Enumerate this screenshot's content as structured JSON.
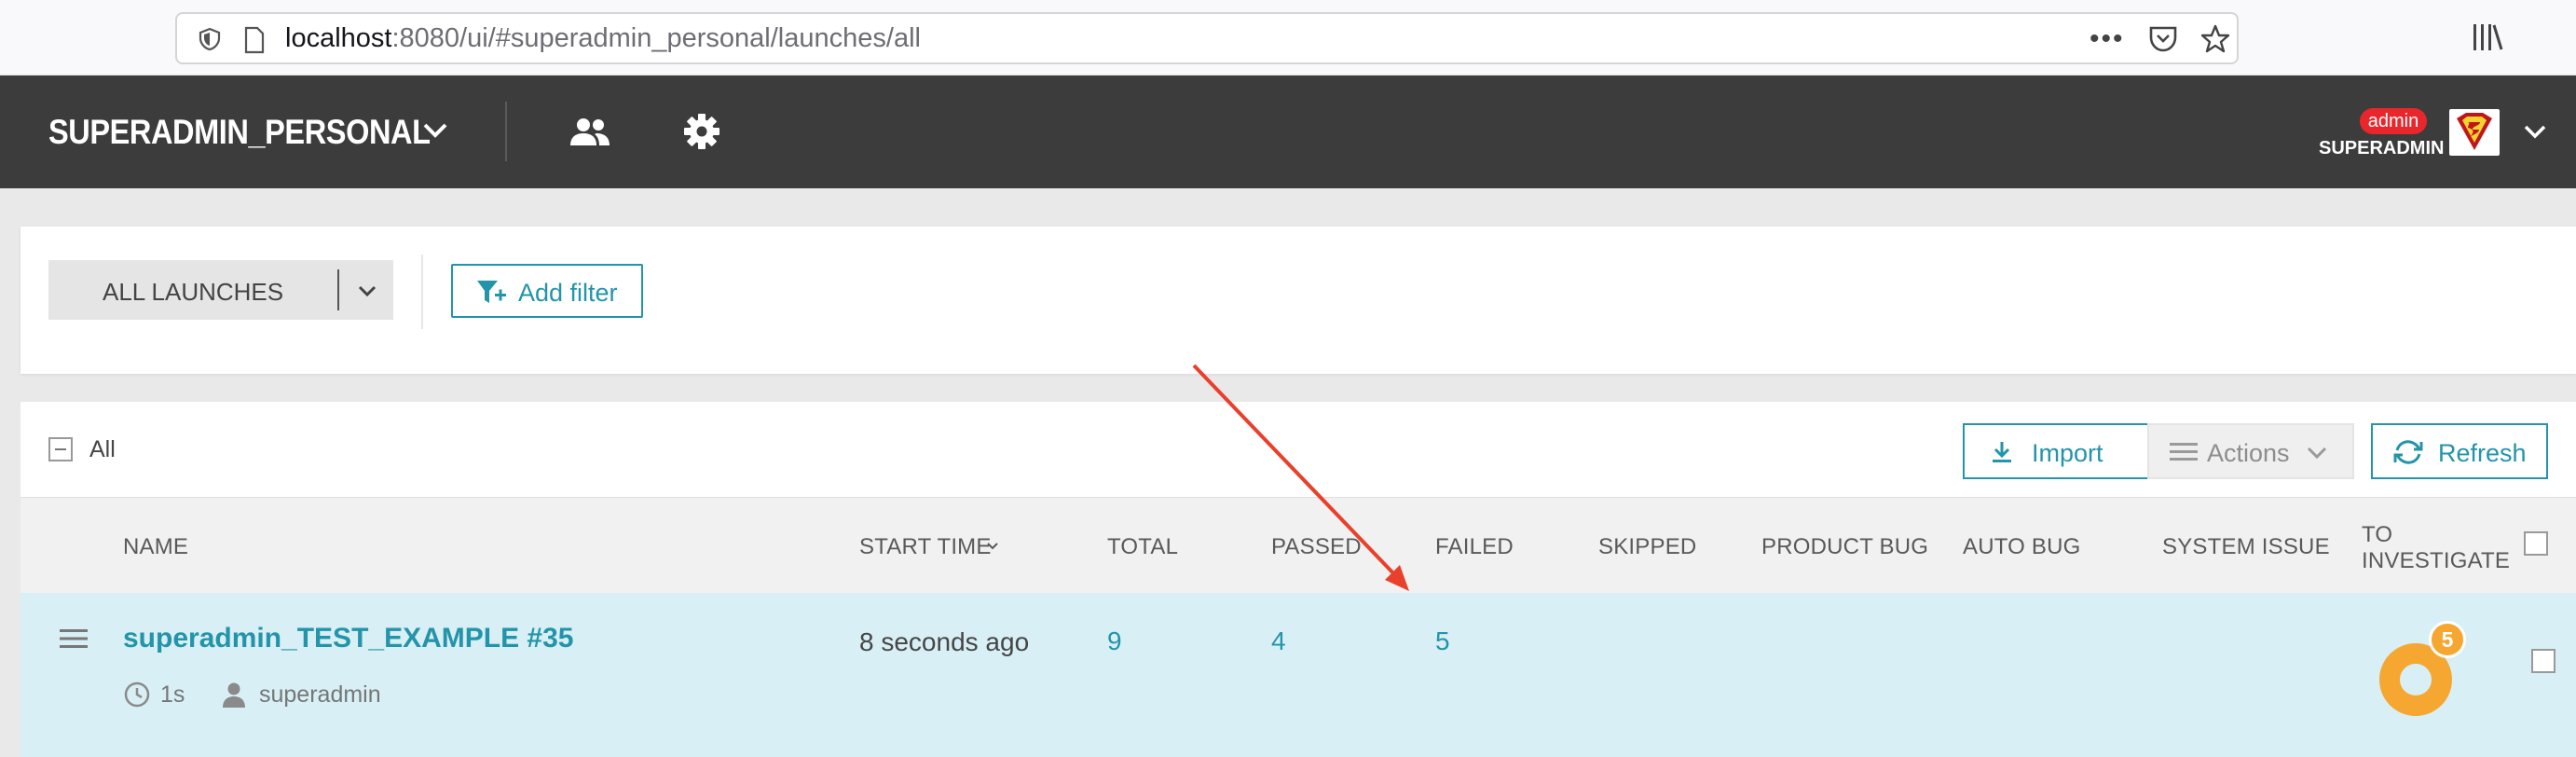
{
  "browser": {
    "url_host": "localhost",
    "url_rest": ":8080/ui/#superadmin_personal/launches/all"
  },
  "header": {
    "project_name": "SUPERADMIN_PERSONAL",
    "user_role": "admin",
    "user_name": "SUPERADMIN"
  },
  "filters": {
    "launch_select": "ALL LAUNCHES",
    "add_filter": "Add filter"
  },
  "toolbar": {
    "all_label": "All",
    "import": "Import",
    "actions": "Actions",
    "refresh": "Refresh"
  },
  "table": {
    "columns": {
      "name": "NAME",
      "start_time": "START TIME",
      "total": "TOTAL",
      "passed": "PASSED",
      "failed": "FAILED",
      "skipped": "SKIPPED",
      "product_bug": "PRODUCT BUG",
      "auto_bug": "AUTO BUG",
      "system_issue": "SYSTEM ISSUE",
      "to_investigate": "TO INVESTIGATE"
    },
    "rows": [
      {
        "name": "superadmin_TEST_EXAMPLE #35",
        "duration": "1s",
        "owner": "superadmin",
        "start_time": "8 seconds ago",
        "total": "9",
        "passed": "4",
        "failed": "5",
        "to_investigate": "5"
      }
    ]
  },
  "colors": {
    "accent": "#2394a9",
    "header_bg": "#3c3c3c",
    "row_highlight": "#d8f0f5",
    "to_investigate": "#f5a732",
    "admin_badge": "#e8262c",
    "annotation_arrow": "#e8402b"
  },
  "icons": [
    "shield-icon",
    "page-icon",
    "more-icon",
    "pocket-icon",
    "star-icon",
    "library-icon",
    "chevron-down-icon",
    "members-icon",
    "gear-icon",
    "filter-add-icon",
    "download-icon",
    "list-icon",
    "refresh-icon",
    "hamburger-icon",
    "clock-icon",
    "user-icon"
  ]
}
